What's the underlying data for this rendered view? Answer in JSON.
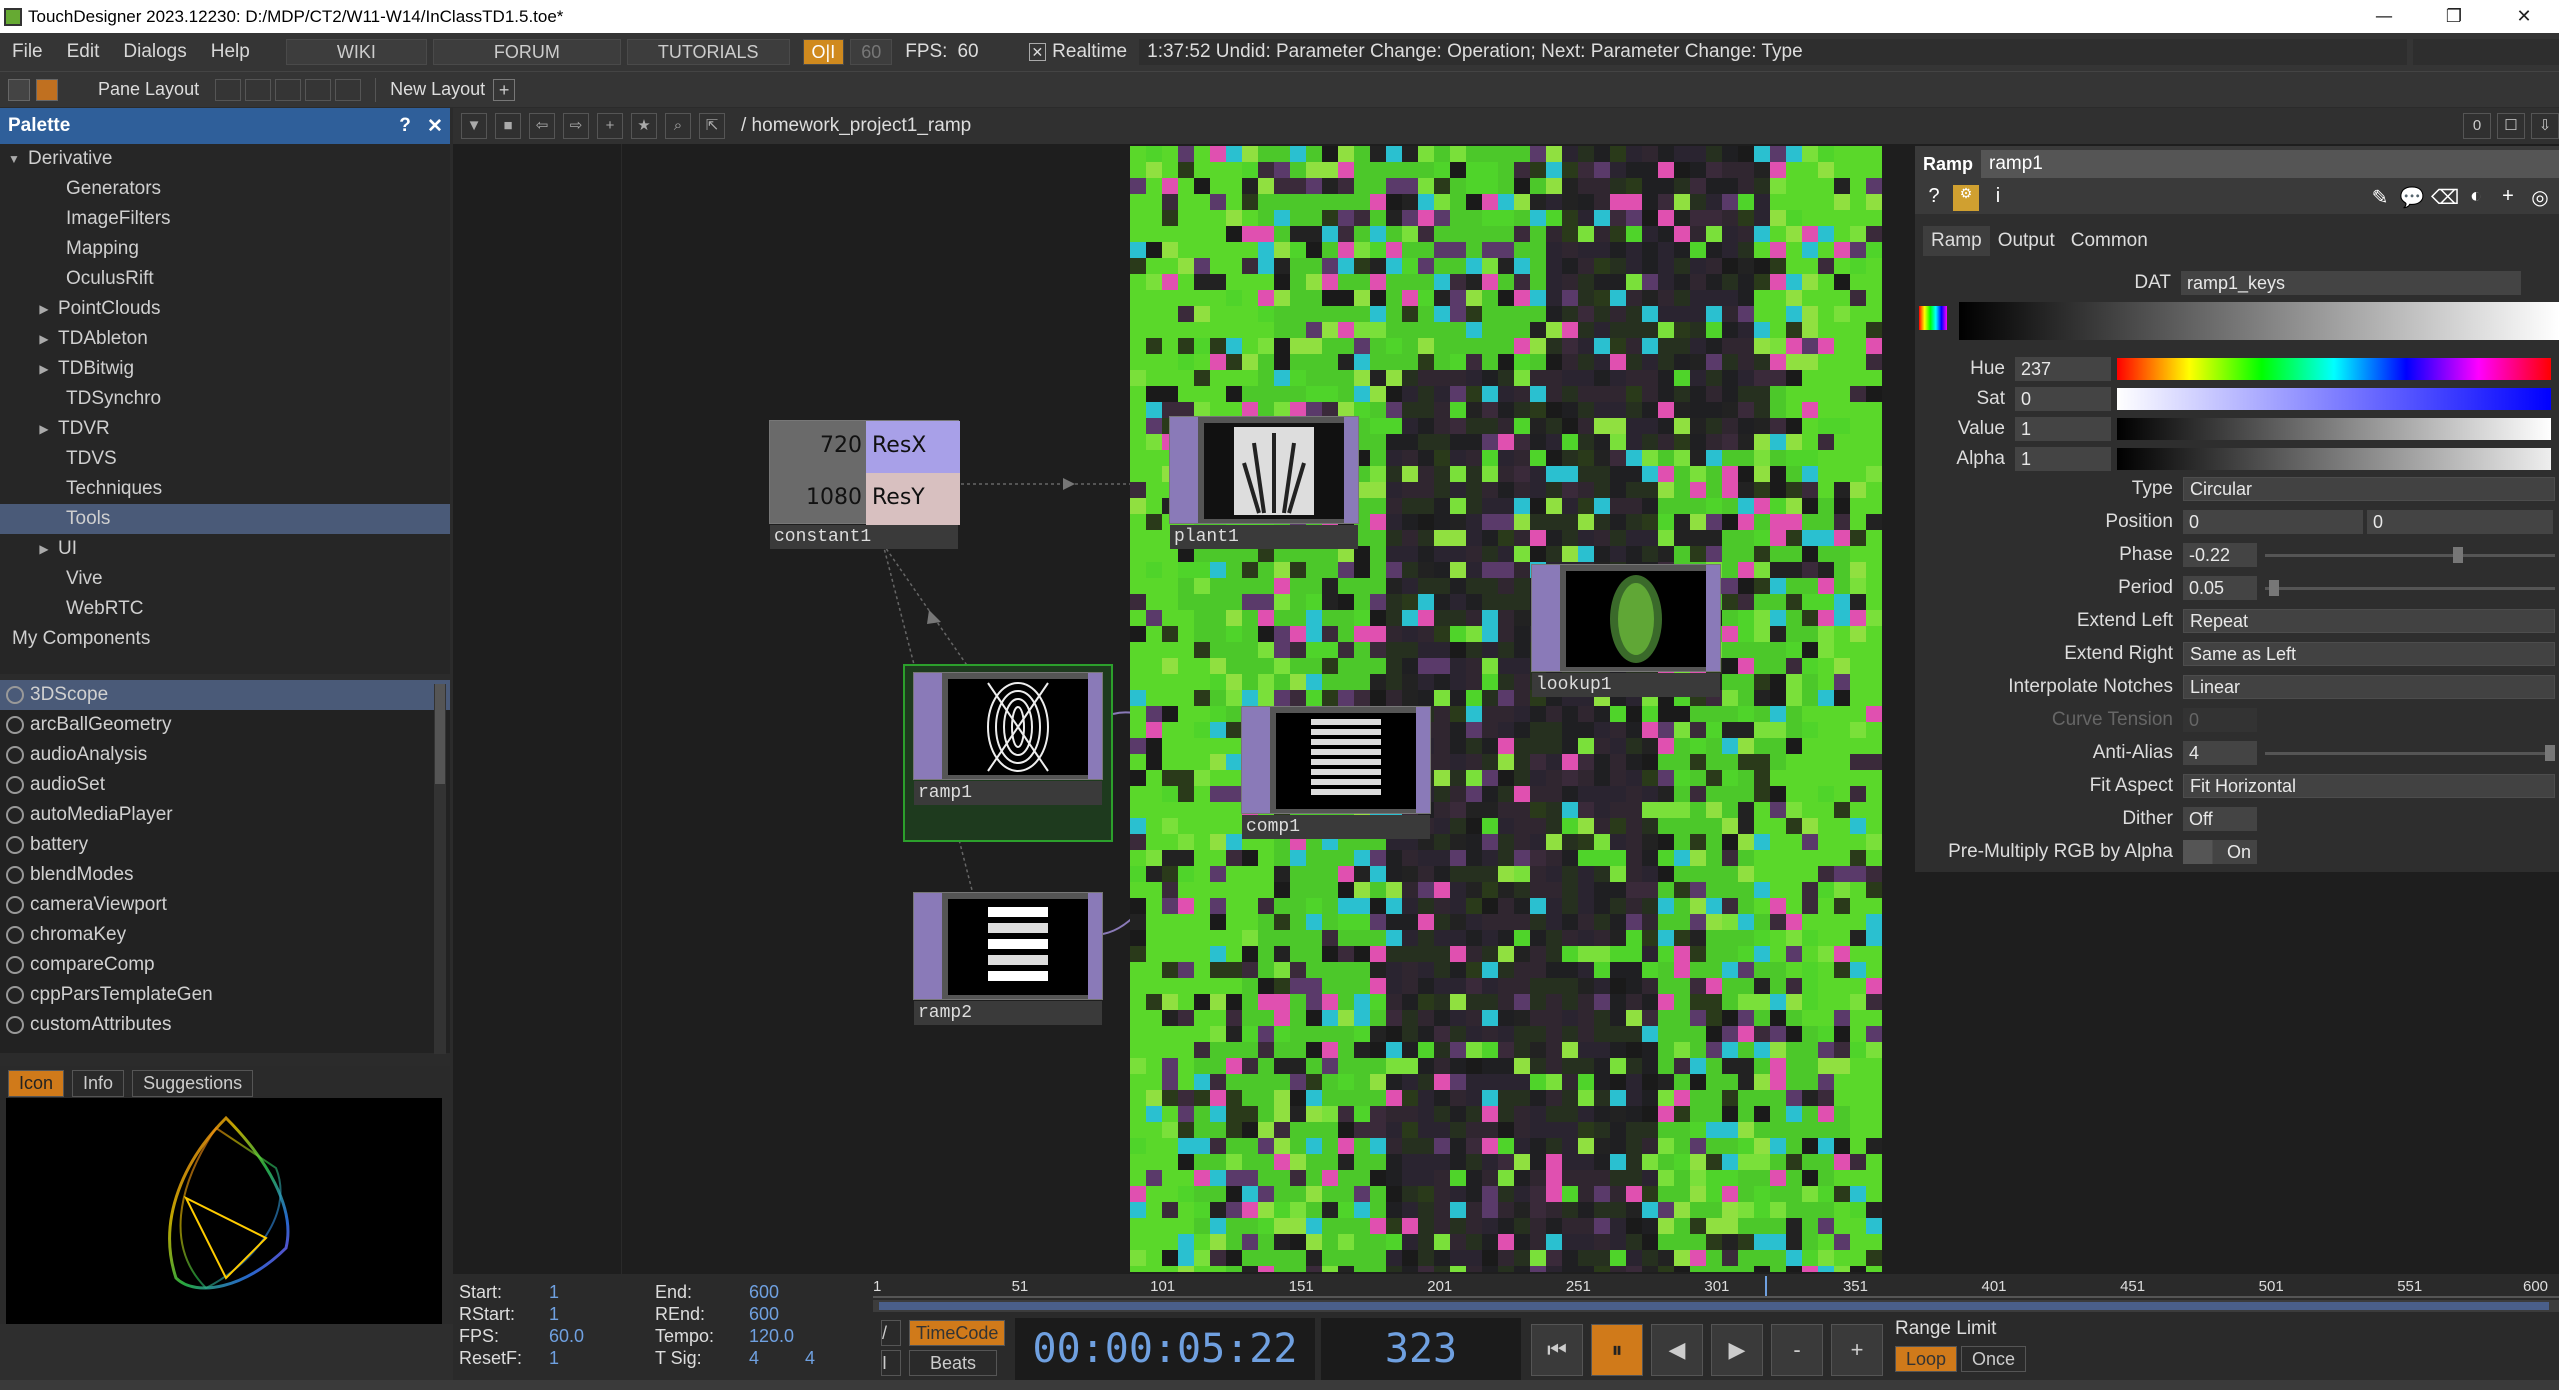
{
  "window": {
    "title": "TouchDesigner 2023.12230: D:/MDP/CT2/W11-W14/InClassTD1.5.toe*",
    "minimize": "—",
    "restore": "❐",
    "close": "✕"
  },
  "menu": {
    "file": "File",
    "edit": "Edit",
    "dialogs": "Dialogs",
    "help": "Help",
    "wiki": "WIKI",
    "forum": "FORUM",
    "tutorials": "TUTORIALS",
    "oi": "O|I",
    "sixty": "60",
    "fps_label": "FPS:",
    "fps_value": "60",
    "realtime_check": "✕",
    "realtime_label": "Realtime",
    "undo_status": "1:37:52 Undid: Parameter Change: Operation; Next: Parameter Change: Type"
  },
  "panebar": {
    "pane_layout": "Pane Layout",
    "new_layout": "New Layout",
    "plus": "+"
  },
  "palette": {
    "title": "Palette",
    "help": "?",
    "close": "✕",
    "tree": [
      {
        "label": "Derivative",
        "arrow": "▼",
        "indent": 0
      },
      {
        "label": "Generators",
        "arrow": "",
        "indent": 2
      },
      {
        "label": "ImageFilters",
        "arrow": "",
        "indent": 2
      },
      {
        "label": "Mapping",
        "arrow": "",
        "indent": 2
      },
      {
        "label": "OculusRift",
        "arrow": "",
        "indent": 2
      },
      {
        "label": "PointClouds",
        "arrow": "▶",
        "indent": 1
      },
      {
        "label": "TDAbleton",
        "arrow": "▶",
        "indent": 1
      },
      {
        "label": "TDBitwig",
        "arrow": "▶",
        "indent": 1
      },
      {
        "label": "TDSynchro",
        "arrow": "",
        "indent": 2
      },
      {
        "label": "TDVR",
        "arrow": "▶",
        "indent": 1
      },
      {
        "label": "TDVS",
        "arrow": "",
        "indent": 2
      },
      {
        "label": "Techniques",
        "arrow": "",
        "indent": 2
      },
      {
        "label": "Tools",
        "arrow": "",
        "indent": 2,
        "selected": true
      },
      {
        "label": "UI",
        "arrow": "▶",
        "indent": 1
      },
      {
        "label": "Vive",
        "arrow": "",
        "indent": 2
      },
      {
        "label": "WebRTC",
        "arrow": "",
        "indent": 2
      },
      {
        "label": "My Components",
        "arrow": "",
        "indent": 0
      }
    ],
    "list": [
      "3DScope",
      "arcBallGeometry",
      "audioAnalysis",
      "audioSet",
      "autoMediaPlayer",
      "battery",
      "blendModes",
      "cameraViewport",
      "chromaKey",
      "compareComp",
      "cppParsTemplateGen",
      "customAttributes"
    ],
    "tabs": [
      "Icon",
      "Info",
      "Suggestions"
    ]
  },
  "network": {
    "path": "/ homework_project1_ramp",
    "right_count": "0",
    "nodes": {
      "constant1": {
        "name": "constant1",
        "resx_val": "720",
        "resx_label": "ResX",
        "resy_val": "1080",
        "resy_label": "ResY"
      },
      "ramp1": {
        "name": "ramp1"
      },
      "ramp2": {
        "name": "ramp2"
      },
      "plant1": {
        "name": "plant1"
      },
      "lookup1": {
        "name": "lookup1"
      },
      "comp1": {
        "name": "comp1"
      }
    }
  },
  "params": {
    "op_type": "Ramp",
    "op_name": "ramp1",
    "tabs": [
      "Ramp",
      "Output",
      "Common"
    ],
    "dat_label": "DAT",
    "dat_value": "ramp1_keys",
    "hue_label": "Hue",
    "hue": "237",
    "sat_label": "Sat",
    "sat": "0",
    "value_label": "Value",
    "value": "1",
    "alpha_label": "Alpha",
    "alpha": "1",
    "type_label": "Type",
    "type": "Circular",
    "position_label": "Position",
    "position_x": "0",
    "position_y": "0",
    "phase_label": "Phase",
    "phase": "-0.22",
    "period_label": "Period",
    "period": "0.05",
    "extend_left_label": "Extend Left",
    "extend_left": "Repeat",
    "extend_right_label": "Extend Right",
    "extend_right": "Same as Left",
    "interp_label": "Interpolate Notches",
    "interp": "Linear",
    "curve_label": "Curve Tension",
    "curve": "0",
    "antialias_label": "Anti-Alias",
    "antialias": "4",
    "fitaspect_label": "Fit Aspect",
    "fitaspect": "Fit Horizontal",
    "dither_label": "Dither",
    "dither": "Off",
    "premult_label": "Pre-Multiply RGB by Alpha",
    "premult": "On"
  },
  "timeline": {
    "start_label": "Start:",
    "start": "1",
    "rstart_label": "RStart:",
    "rstart": "1",
    "fps_label": "FPS:",
    "fps": "60.0",
    "resetf_label": "ResetF:",
    "resetf": "1",
    "end_label": "End:",
    "end": "600",
    "rend_label": "REnd:",
    "rend": "600",
    "tempo_label": "Tempo:",
    "tempo": "120.0",
    "tsig_label": "T Sig:",
    "tsig_a": "4",
    "tsig_b": "4",
    "ticks": [
      "1",
      "51",
      "101",
      "151",
      "201",
      "251",
      "301",
      "351",
      "401",
      "451",
      "501",
      "551",
      "600"
    ],
    "timecode_btn": "TimeCode",
    "beats_btn": "Beats",
    "timecode": "00:00:05:22",
    "frame": "323",
    "range_limit": "Range Limit",
    "loop": "Loop",
    "once": "Once",
    "minus": "-",
    "plus": "+"
  }
}
